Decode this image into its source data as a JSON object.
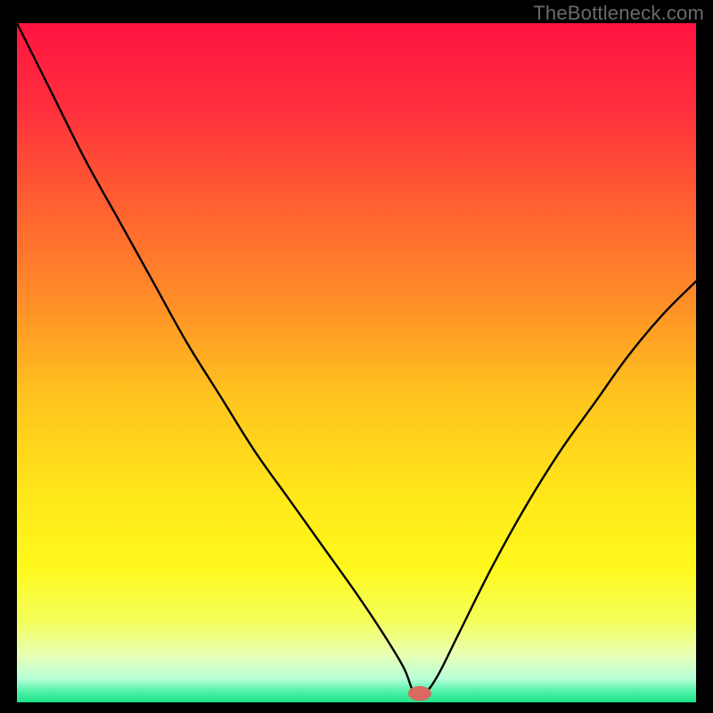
{
  "watermark": "TheBottleneck.com",
  "colors": {
    "frame": "#000000",
    "curve": "#000000",
    "marker_fill": "#d96a60",
    "gradient_stops": [
      {
        "offset": 0.0,
        "color": "#ff1440"
      },
      {
        "offset": 0.12,
        "color": "#ff2e3e"
      },
      {
        "offset": 0.25,
        "color": "#ff5a32"
      },
      {
        "offset": 0.4,
        "color": "#ff8a28"
      },
      {
        "offset": 0.55,
        "color": "#ffc41e"
      },
      {
        "offset": 0.7,
        "color": "#ffe81a"
      },
      {
        "offset": 0.8,
        "color": "#fff81c"
      },
      {
        "offset": 0.88,
        "color": "#f4ff5a"
      },
      {
        "offset": 0.93,
        "color": "#e8ffb4"
      },
      {
        "offset": 0.965,
        "color": "#b8ffd8"
      },
      {
        "offset": 0.985,
        "color": "#4cf1a6"
      },
      {
        "offset": 1.0,
        "color": "#1ee28a"
      }
    ]
  },
  "chart_data": {
    "type": "line",
    "title": "",
    "xlabel": "",
    "ylabel": "",
    "xlim": [
      0,
      100
    ],
    "ylim": [
      0,
      100
    ],
    "series": [
      {
        "name": "bottleneck-curve",
        "x": [
          0,
          5,
          10,
          15,
          20,
          25,
          30,
          35,
          40,
          45,
          50,
          54,
          57,
          58.5,
          60,
          62,
          65,
          70,
          75,
          80,
          85,
          90,
          95,
          100
        ],
        "y": [
          100,
          90,
          80,
          71,
          62,
          53,
          45,
          37,
          30,
          23,
          16,
          10,
          5,
          1.3,
          1.3,
          4,
          10,
          20,
          29,
          37,
          44,
          51,
          57,
          62
        ]
      }
    ],
    "marker": {
      "x": 59.3,
      "y": 1.3,
      "rx": 1.7,
      "ry": 1.1,
      "label": "optimal-point"
    }
  }
}
